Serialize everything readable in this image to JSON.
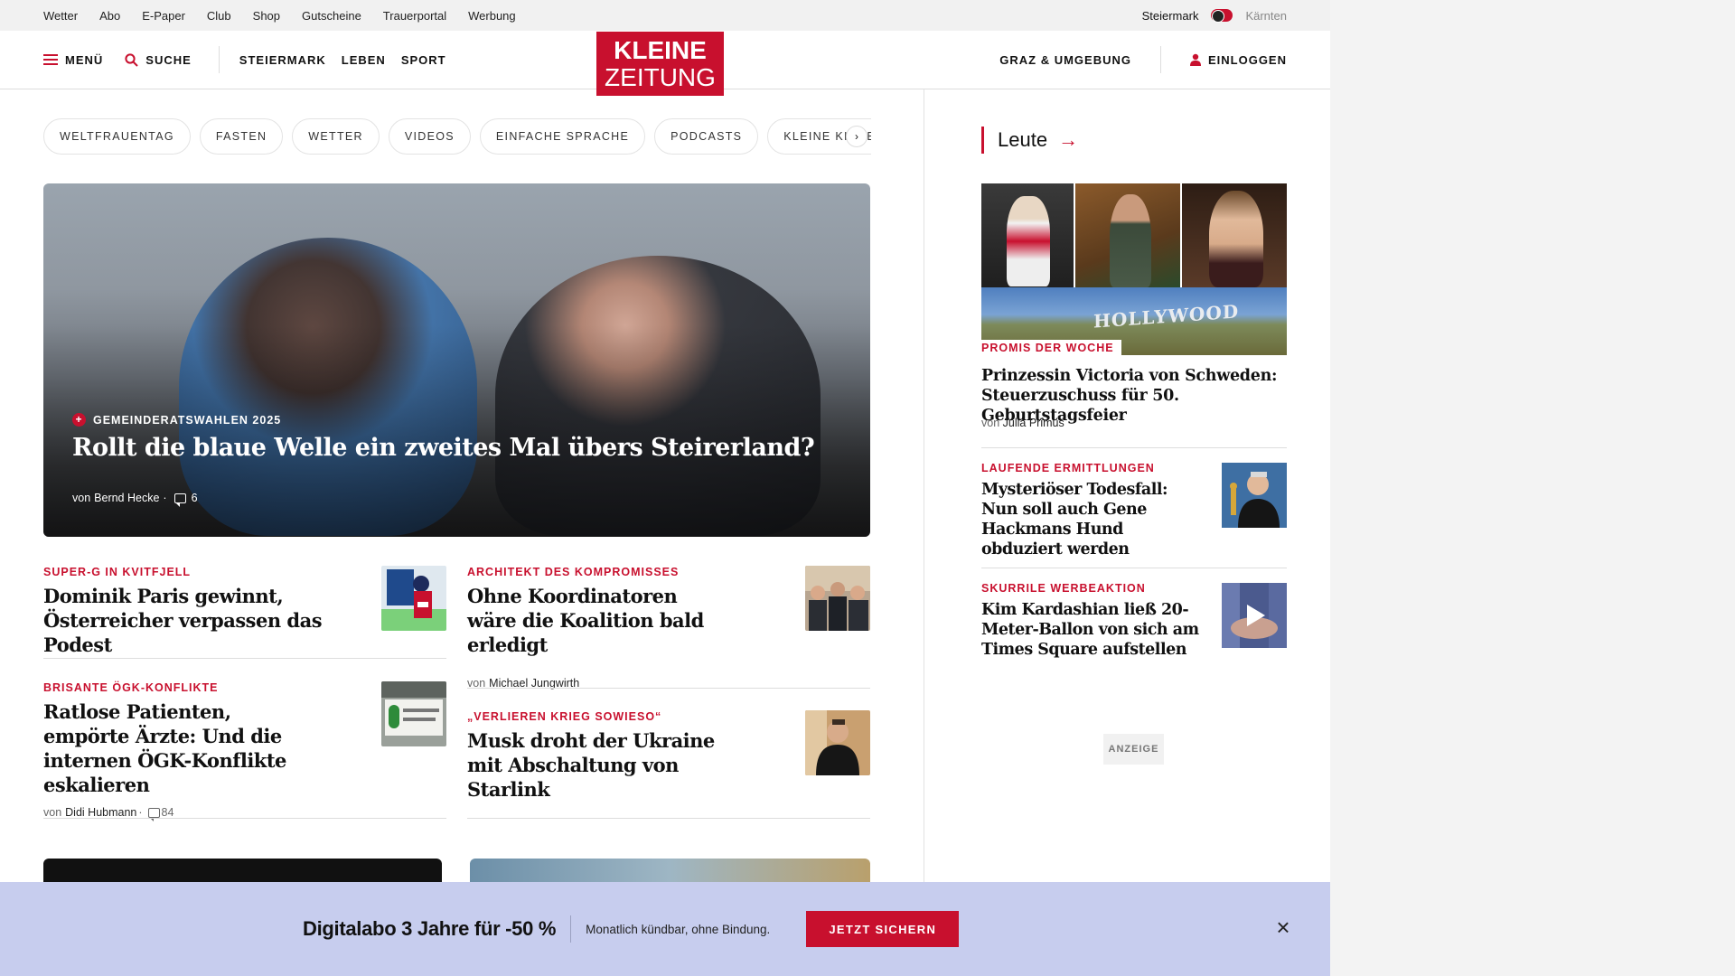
{
  "utility": {
    "links": [
      "Wetter",
      "Abo",
      "E-Paper",
      "Club",
      "Shop",
      "Gutscheine",
      "Trauerportal",
      "Werbung"
    ],
    "region_active": "Steiermark",
    "region_inactive": "Kärnten"
  },
  "nav": {
    "menu": "MENÜ",
    "search": "SUCHE",
    "sections": [
      "STEIERMARK",
      "LEBEN",
      "SPORT"
    ],
    "logo_line1": "KLEINE",
    "logo_line2": "ZEITUNG",
    "region_link": "GRAZ & UMGEBUNG",
    "login": "EINLOGGEN"
  },
  "tags": [
    "WELTFRAUENTAG",
    "FASTEN",
    "WETTER",
    "VIDEOS",
    "EINFACHE SPRACHE",
    "PODCASTS",
    "KLEINE KINDERZEITUNG"
  ],
  "hero": {
    "kicker": "GEMEINDERATSWAHLEN 2025",
    "title": "Rollt die blaue Welle ein zweites Mal übers Steirerland?",
    "by": "von",
    "author": "Bernd Hecke",
    "comments": "6"
  },
  "articles": {
    "a1": {
      "kicker": "SUPER-G IN KVITFJELL",
      "title": "Dominik Paris gewinnt, Österreicher verpassen das Podest"
    },
    "a2": {
      "kicker": "ARCHITEKT DES KOMPROMISSES",
      "title": "Ohne Koordinatoren wäre die Koalition bald erledigt",
      "by": "von",
      "author": "Michael Jungwirth"
    },
    "a3": {
      "kicker": "BRISANTE ÖGK-KONFLIKTE",
      "title": "Ratlose Patienten, empörte Ärzte: Und die internen ÖGK-Konflikte eskalieren",
      "by": "von",
      "author": "Didi Hubmann",
      "comments": "84"
    },
    "a4": {
      "kicker": "„VERLIEREN KRIEG SOWIESO“",
      "title": "Musk droht der Ukraine mit Abschaltung von Starlink"
    }
  },
  "sidebar": {
    "heading": "Leute",
    "collage_text": "HOLLYWOOD",
    "main": {
      "kicker": "PROMIS DER WOCHE",
      "title": "Prinzessin Victoria von Schweden: Steuerzuschuss für 50. Geburtstagsfeier",
      "by": "von",
      "author": "Julia Primus"
    },
    "items": [
      {
        "kicker": "LAUFENDE ERMITTLUNGEN",
        "title": "Mysteriöser Todesfall: Nun soll auch Gene Hackmans Hund obduziert werden"
      },
      {
        "kicker": "SKURRILE WERBEAKTION",
        "title": "Kim Kardashian ließ 20-Meter-Ballon von sich am Times Square aufstellen"
      }
    ],
    "ad_label": "ANZEIGE"
  },
  "banner": {
    "title": "Digitalabo 3 Jahre für -50 %",
    "subtitle": "Monatlich kündbar, ohne Bindung.",
    "button": "JETZT SICHERN"
  },
  "colors": {
    "brand_red": "#c8102e",
    "banner_bg": "#c7cdee",
    "utility_bg": "#f1f1f1"
  }
}
